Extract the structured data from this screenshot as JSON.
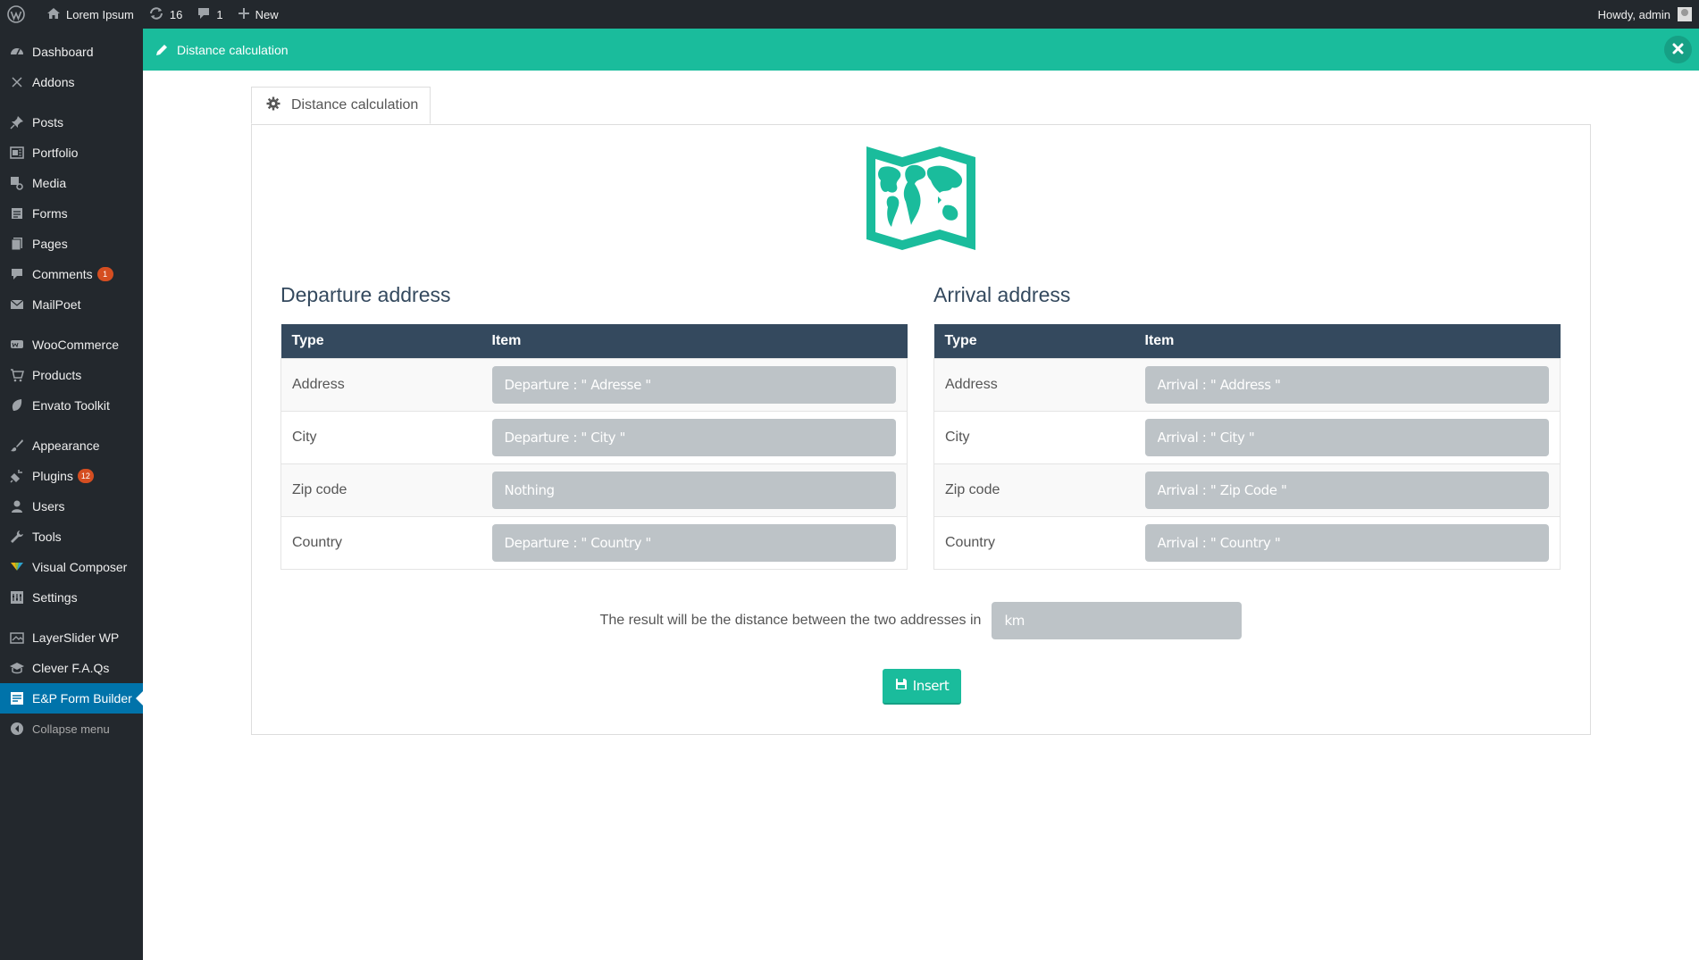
{
  "adminbar": {
    "site_name": "Lorem Ipsum",
    "updates_count": "16",
    "comments_count": "1",
    "new_label": "New",
    "howdy": "Howdy, admin"
  },
  "sidebar": {
    "items": [
      {
        "label": "Dashboard",
        "icon": "dashboard-icon"
      },
      {
        "label": "Addons",
        "icon": "addons-icon"
      },
      {
        "label": "Posts",
        "icon": "pin-icon"
      },
      {
        "label": "Portfolio",
        "icon": "portfolio-icon"
      },
      {
        "label": "Media",
        "icon": "media-icon"
      },
      {
        "label": "Forms",
        "icon": "forms-icon"
      },
      {
        "label": "Pages",
        "icon": "pages-icon"
      },
      {
        "label": "Comments",
        "icon": "comment-icon",
        "badge": "1"
      },
      {
        "label": "MailPoet",
        "icon": "mail-icon"
      },
      {
        "label": "WooCommerce",
        "icon": "woocommerce-icon"
      },
      {
        "label": "Products",
        "icon": "cart-icon"
      },
      {
        "label": "Envato Toolkit",
        "icon": "leaf-icon"
      },
      {
        "label": "Appearance",
        "icon": "brush-icon"
      },
      {
        "label": "Plugins",
        "icon": "plugin-icon",
        "badge": "12"
      },
      {
        "label": "Users",
        "icon": "user-icon"
      },
      {
        "label": "Tools",
        "icon": "wrench-icon"
      },
      {
        "label": "Visual Composer",
        "icon": "visual-composer-icon"
      },
      {
        "label": "Settings",
        "icon": "settings-icon"
      },
      {
        "label": "LayerSlider WP",
        "icon": "layers-icon"
      },
      {
        "label": "Clever F.A.Qs",
        "icon": "graduation-cap-icon"
      },
      {
        "label": "E&P Form Builder",
        "icon": "form-builder-icon"
      }
    ],
    "collapse_label": "Collapse menu"
  },
  "header": {
    "title": "Distance calculation"
  },
  "tab": {
    "label": "Distance calculation"
  },
  "departure": {
    "title": "Departure address",
    "col_type": "Type",
    "col_item": "Item",
    "rows": [
      {
        "type": "Address",
        "value": "Departure : \" Adresse \""
      },
      {
        "type": "City",
        "value": "Departure : \" City \""
      },
      {
        "type": "Zip code",
        "value": "Nothing"
      },
      {
        "type": "Country",
        "value": "Departure : \" Country \""
      }
    ]
  },
  "arrival": {
    "title": "Arrival address",
    "col_type": "Type",
    "col_item": "Item",
    "rows": [
      {
        "type": "Address",
        "value": "Arrival : \" Address \""
      },
      {
        "type": "City",
        "value": "Arrival : \" City \""
      },
      {
        "type": "Zip code",
        "value": "Arrival : \" Zip Code \""
      },
      {
        "type": "Country",
        "value": "Arrival : \" Country \""
      }
    ]
  },
  "result": {
    "text": "The result will be the distance between the two addresses in",
    "unit": "km"
  },
  "insert_label": "Insert",
  "colors": {
    "accent": "#1abc9c",
    "header_dark": "#34495e",
    "field_bg": "#bdc3c7",
    "admin_dark": "#23282d",
    "active_blue": "#0073aa"
  }
}
